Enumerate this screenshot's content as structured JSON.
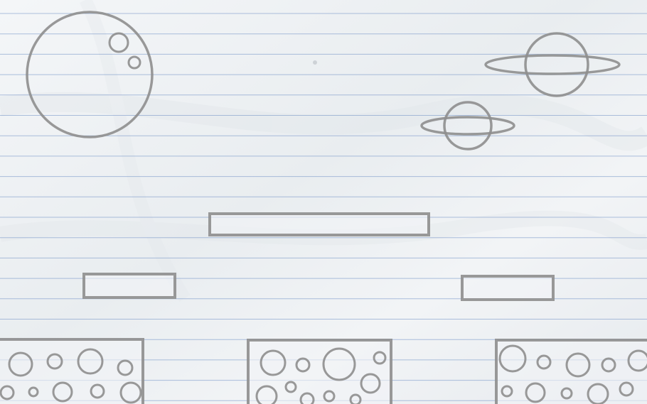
{
  "scene": {
    "name": "doodle-space-level",
    "background": {
      "paper_color": "#eef1f4",
      "rule_line_color": "#6f8fc4",
      "ruled": true
    },
    "sketch": {
      "stroke_color": "#8e8e8e",
      "fill_color": "#f2f4f6"
    },
    "objects": {
      "moon": {
        "kind": "cratered-moon",
        "crater_count": 2
      },
      "planets": [
        {
          "kind": "ringed-planet",
          "size": "large"
        },
        {
          "kind": "ringed-planet",
          "size": "small"
        }
      ],
      "floating_platforms": [
        {
          "kind": "platform",
          "size": "long"
        },
        {
          "kind": "platform",
          "size": "short"
        },
        {
          "kind": "platform",
          "size": "short"
        }
      ],
      "ground_blocks": [
        {
          "kind": "cratered-block"
        },
        {
          "kind": "cratered-block"
        },
        {
          "kind": "cratered-block"
        }
      ],
      "star_count": 1
    }
  }
}
